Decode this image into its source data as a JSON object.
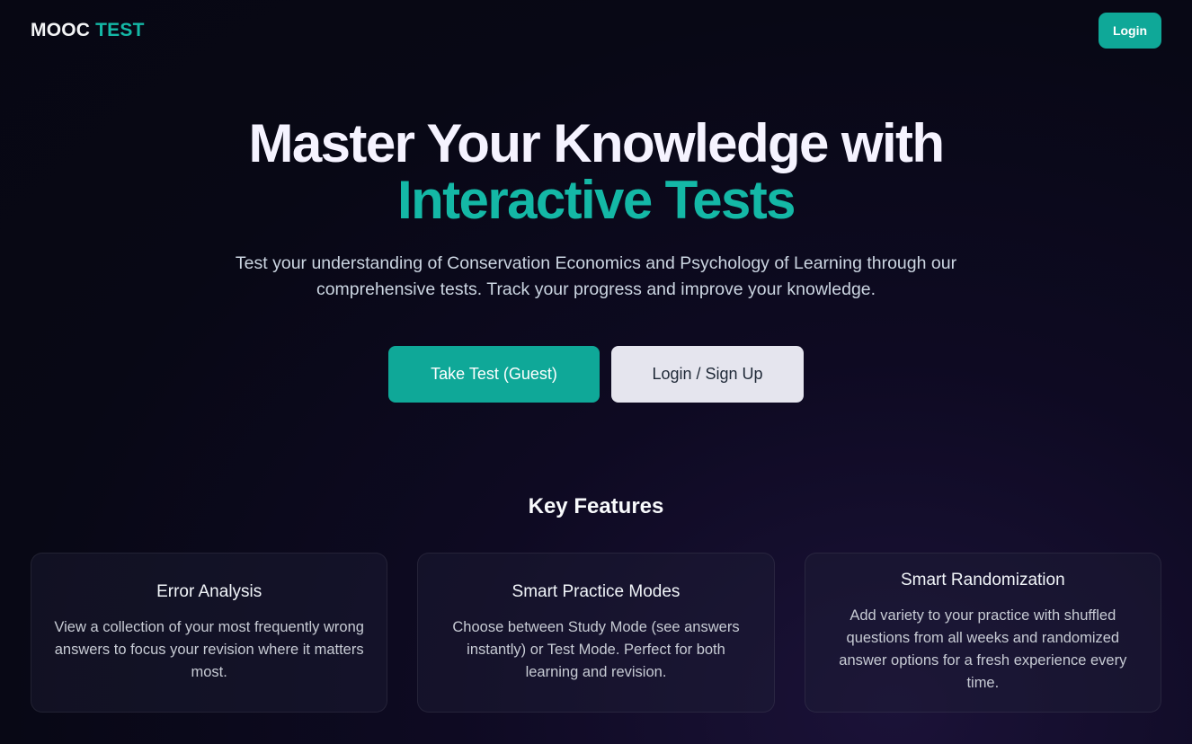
{
  "brand": {
    "part1": "MOOC",
    "part2": "TEST"
  },
  "nav": {
    "login_label": "Login"
  },
  "hero": {
    "title_line1": "Master Your Knowledge with",
    "title_line2": "Interactive Tests",
    "subtitle": "Test your understanding of Conservation Economics and Psychology of Learning through our comprehensive tests. Track your progress and improve your knowledge."
  },
  "cta": {
    "primary_label": "Take Test (Guest)",
    "secondary_label": "Login / Sign Up"
  },
  "features": {
    "title": "Key Features",
    "items": [
      {
        "title": "Error Analysis",
        "text": "View a collection of your most frequently wrong answers to focus your revision where it matters most."
      },
      {
        "title": "Smart Practice Modes",
        "text": "Choose between Study Mode (see answers instantly) or Test Mode. Perfect for both learning and revision."
      },
      {
        "title": "Smart Randomization",
        "text": "Add variety to your practice with shuffled questions from all weeks and randomized answer options for a fresh experience every time."
      }
    ]
  },
  "colors": {
    "accent": "#14b8a6",
    "button_primary": "#0fa898",
    "button_secondary": "#e5e5ee",
    "background": "#080815"
  }
}
